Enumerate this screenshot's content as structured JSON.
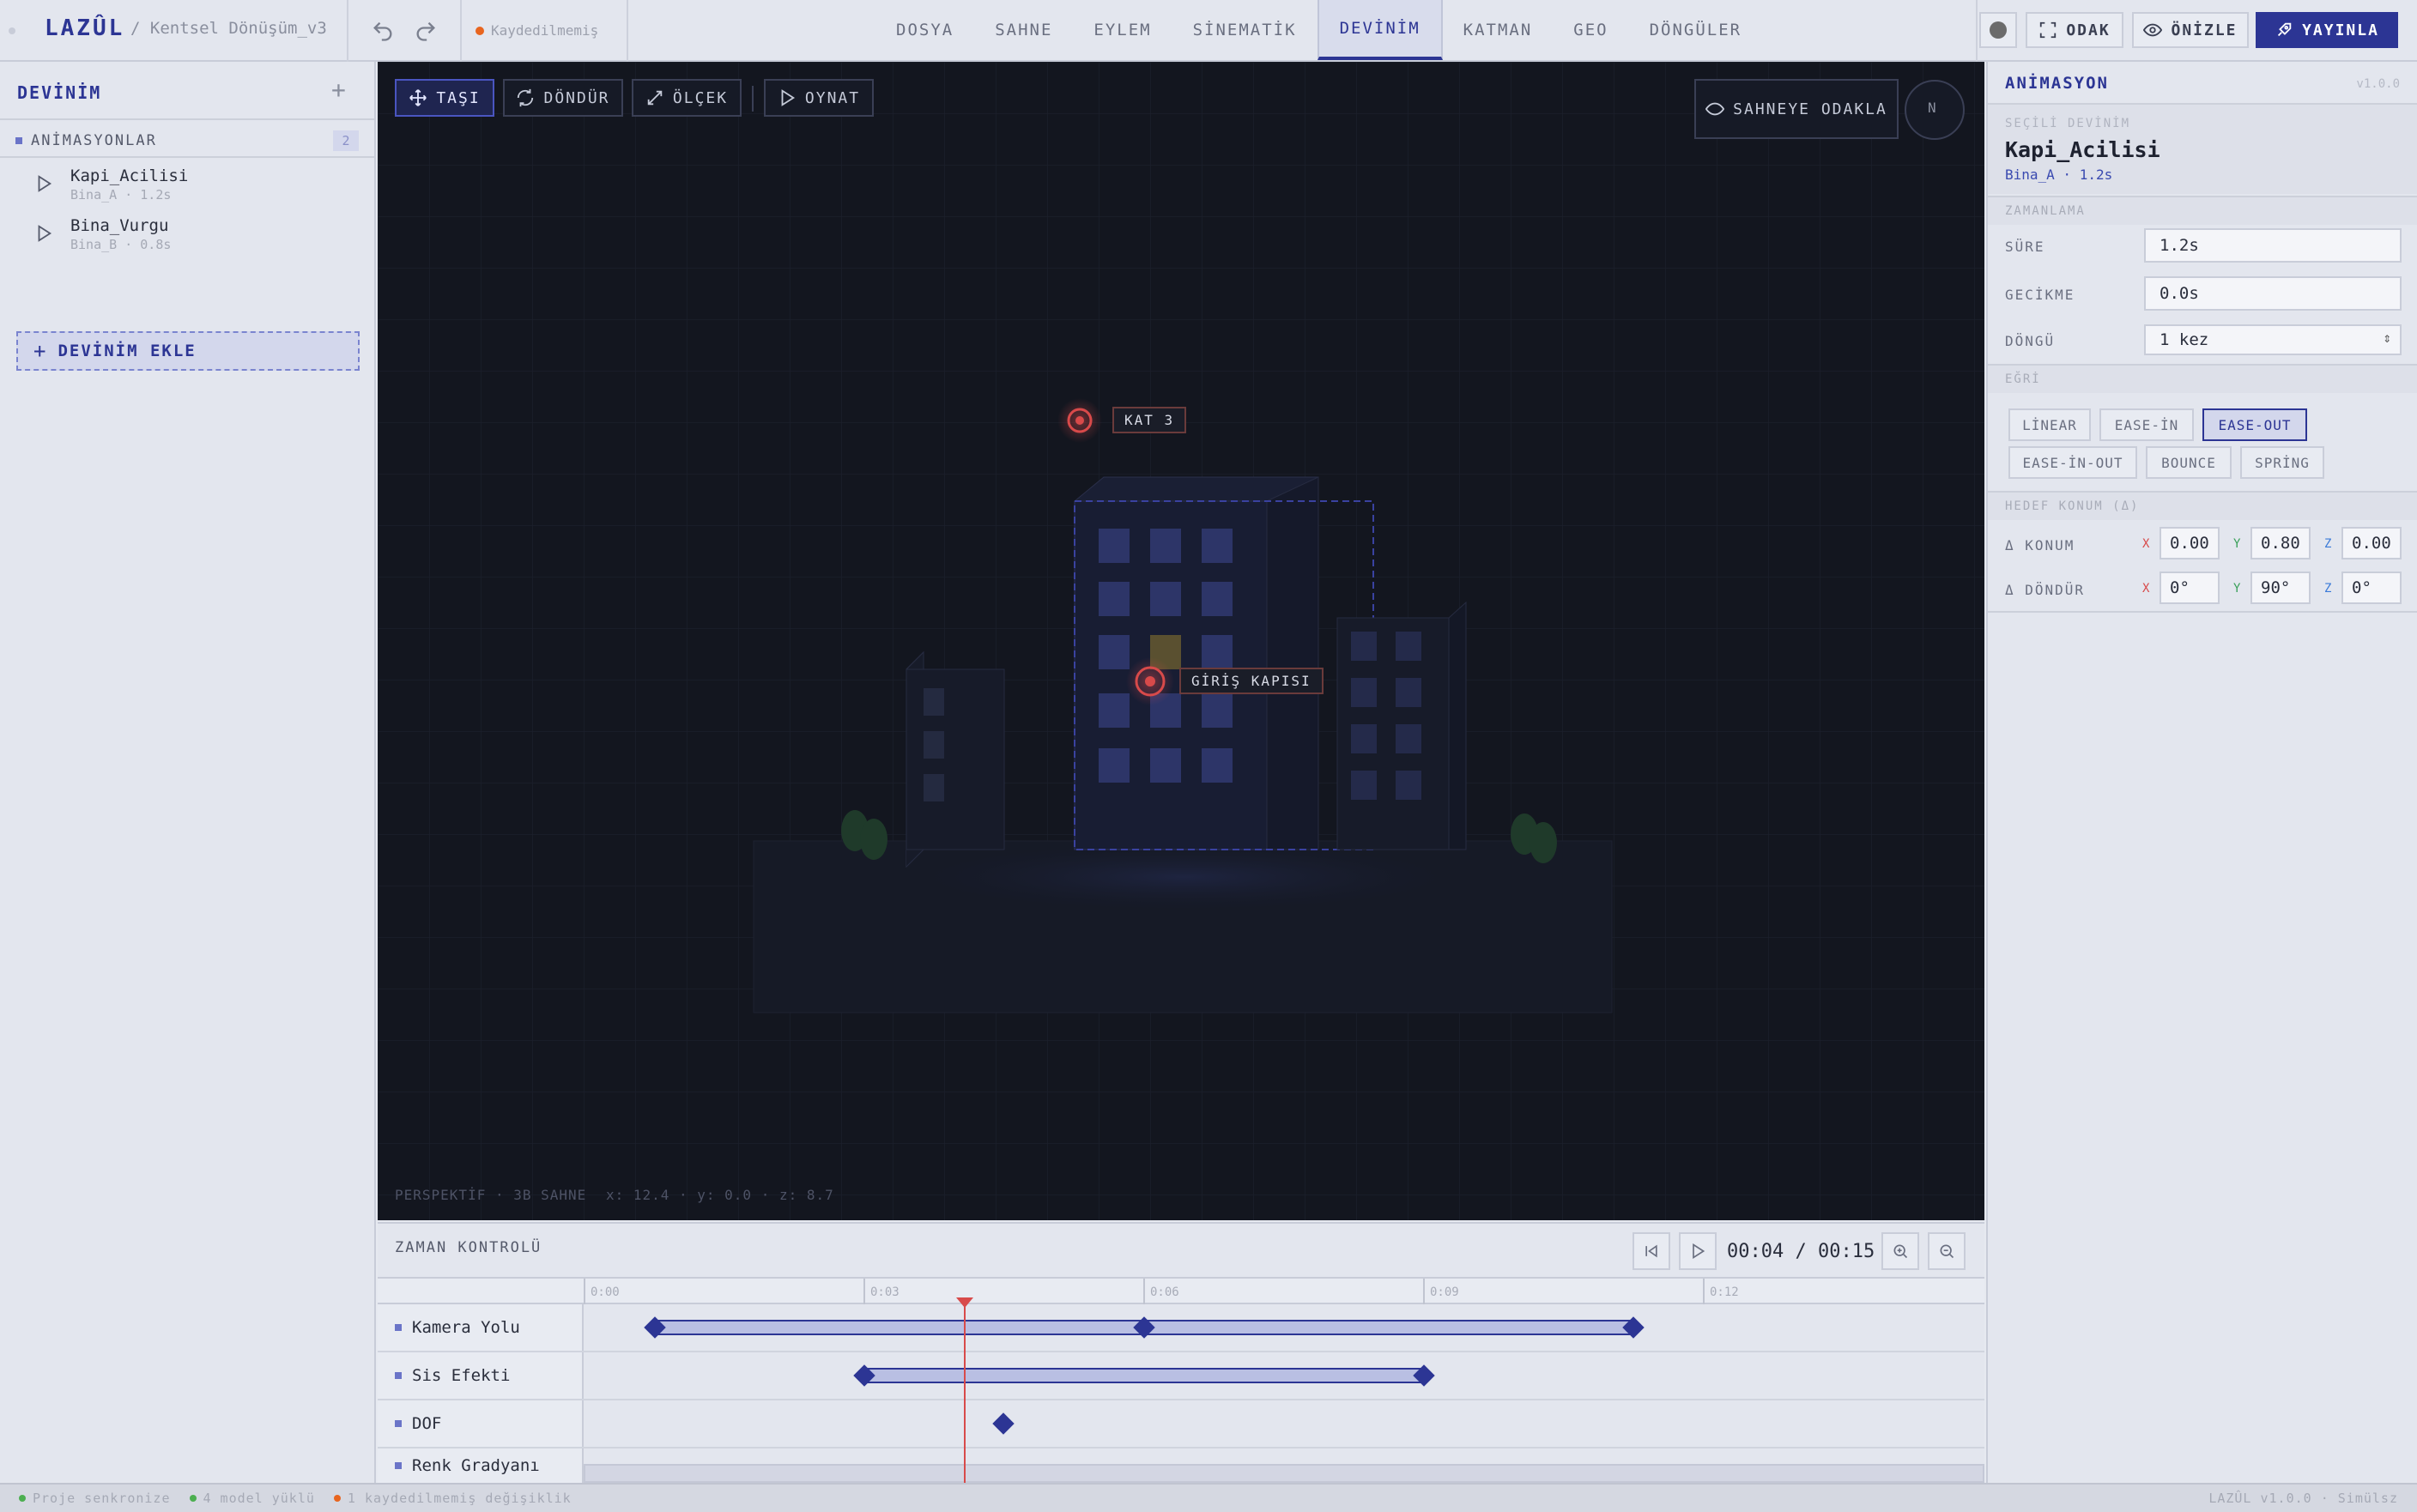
{
  "header": {
    "brand": "LAZÛL",
    "project": "/ Kentsel Dönüşüm_v3",
    "unsaved": "Kaydedilmemiş",
    "menu": [
      "DOSYA",
      "SAHNE",
      "EYLEM",
      "SİNEMATİK",
      "DEVİNİM",
      "KATMAN",
      "GEO",
      "DÖNGÜLER"
    ],
    "active_menu": "DEVİNİM",
    "focus_btn": "ODAK",
    "preview_btn": "ÖNİZLE",
    "publish_btn": "YAYINLA",
    "status_dot_color": "#6b6b6b"
  },
  "left_panel": {
    "title": "DEVİNİM",
    "add_icon": "+",
    "section": "ANİMASYONLAR",
    "count": "2",
    "items": [
      {
        "name": "Kapi_Acilisi",
        "sub": "Bina_A · 1.2s"
      },
      {
        "name": "Bina_Vurgu",
        "sub": "Bina_B · 0.8s"
      }
    ],
    "add_button": "DEVİNİM EKLE"
  },
  "viewport": {
    "tools": [
      "TAŞI",
      "DÖNDÜR",
      "ÖLÇEK",
      "OYNAT"
    ],
    "focus_scene": "SAHNEYE ODAKLA",
    "compass": "N",
    "markers": [
      "KAT 3",
      "GİRİŞ KAPISI"
    ],
    "info": "PERSPEKTİF · 3B SAHNE",
    "coords": "x: 12.4 · y: 0.0 · z: 8.7"
  },
  "right_panel": {
    "title": "ANİMASYON",
    "version": "v1.0.0",
    "selected_label": "SEÇİLİ DEVİNİM",
    "selected_name": "Kapi_Acilisi",
    "selected_sub": "Bina_A · 1.2s",
    "timing_section": "ZAMANLAMA",
    "duration_label": "SÜRE",
    "duration_value": "1.2s",
    "delay_label": "GECİKME",
    "delay_value": "0.0s",
    "loop_label": "DÖNGÜ",
    "loop_value": "1 kez",
    "curve_section": "EĞRİ",
    "curves": [
      "LİNEAR",
      "EASE-İN",
      "EASE-OUT",
      "EASE-İN-OUT",
      "BOUNCE",
      "SPRİNG"
    ],
    "active_curve": "EASE-OUT",
    "target_section": "HEDEF KONUM (Δ)",
    "position_label": "Δ KONUM",
    "position": {
      "x": "0.00",
      "y": "0.80",
      "z": "0.00"
    },
    "rotation_label": "Δ DÖNDÜR",
    "rotation": {
      "x": "0°",
      "y": "90°",
      "z": "0°"
    },
    "axis_labels": {
      "x": "X",
      "y": "Y",
      "z": "Z"
    },
    "axis_colors": {
      "x": "#d84a4a",
      "y": "#3aa05a",
      "z": "#3a7ad8"
    }
  },
  "timeline": {
    "title": "ZAMAN KONTROLÜ",
    "time": "00:04 / 00:15",
    "ticks": [
      "0:00",
      "0:03",
      "0:06",
      "0:09",
      "0:12"
    ],
    "tracks": [
      "Kamera Yolu",
      "Sis Efekti",
      "DOF",
      "Renk Gradyanı"
    ]
  },
  "statusbar": {
    "items": [
      {
        "text": "Proje senkronize",
        "color": "#4caf50"
      },
      {
        "text": "4 model yüklü",
        "color": "#4caf50"
      },
      {
        "text": "1 kaydedilmemiş değişiklik",
        "color": "#e8651f"
      }
    ],
    "version": "LAZÛL v1.0.0 · Simülsz"
  }
}
